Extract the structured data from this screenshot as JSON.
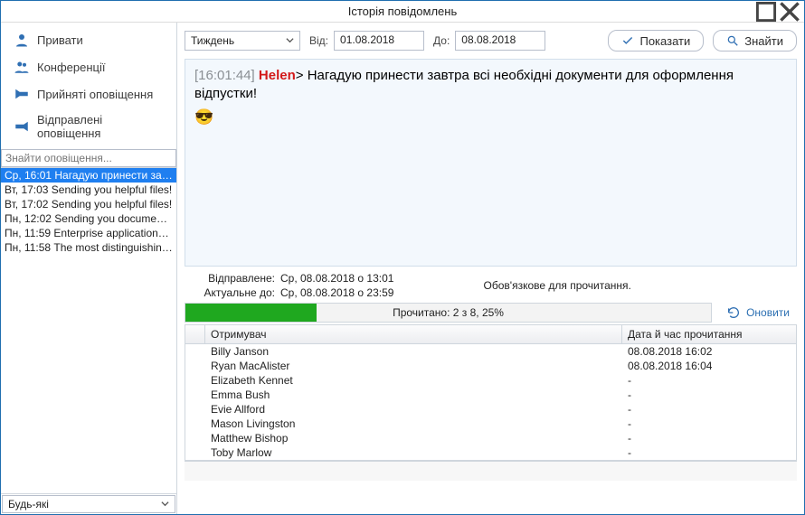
{
  "window": {
    "title": "Історія повідомлень"
  },
  "sidebar": {
    "cats": [
      {
        "label": "Привати",
        "icon": "user"
      },
      {
        "label": "Конференції",
        "icon": "group"
      },
      {
        "label": "Прийняті оповіщення",
        "icon": "announce-in"
      },
      {
        "label": "Відправлені оповіщення",
        "icon": "announce-out"
      }
    ],
    "search_placeholder": "Знайти оповіщення...",
    "search_value": "",
    "items": [
      "Ср, 16:01 Нагадую принести завтра...",
      "Вт, 17:03 Sending you helpful files!",
      "Вт, 17:02 Sending you helpful files!",
      "Пн, 12:02 Sending you documents th...",
      "Пн, 11:59 Enterprise applications are ...",
      "Пн, 11:58 The most distinguishing and..."
    ],
    "bottom_select": "Будь-які"
  },
  "filter": {
    "period": "Тиждень",
    "from_label": "Від:",
    "from": "01.08.2018",
    "to_label": "До:",
    "to": "08.08.2018",
    "show_btn": "Показати",
    "find_btn": "Знайти"
  },
  "message": {
    "time": "[16:01:44]",
    "sender": "Helen",
    "arrow": ">",
    "text": "Нагадую принести завтра всі необхідні документи для оформлення відпустки!",
    "emoji": "😎"
  },
  "meta": {
    "sent_k": "Відправлене:",
    "sent_v": "Ср, 08.08.2018 о 13:01",
    "valid_k": "Актуальне до:",
    "valid_v": "Ср, 08.08.2018 о 23:59",
    "mandatory": "Обов'язкове для прочитання."
  },
  "progress": {
    "percent": 25,
    "label": "Прочитано: 2 з 8, 25%",
    "refresh": "Оновити"
  },
  "table": {
    "h_recipient": "Отримувач",
    "h_time": "Дата й час прочитання",
    "rows": [
      {
        "name": "Billy Janson",
        "time": "08.08.2018 16:02"
      },
      {
        "name": "Ryan MacAlister",
        "time": "08.08.2018 16:04"
      },
      {
        "name": "Elizabeth Kennet",
        "time": "-"
      },
      {
        "name": "Emma Bush",
        "time": "-"
      },
      {
        "name": "Evie Allford",
        "time": "-"
      },
      {
        "name": "Mason Livingston",
        "time": "-"
      },
      {
        "name": "Matthew Bishop",
        "time": "-"
      },
      {
        "name": "Toby Marlow",
        "time": "-"
      }
    ]
  }
}
